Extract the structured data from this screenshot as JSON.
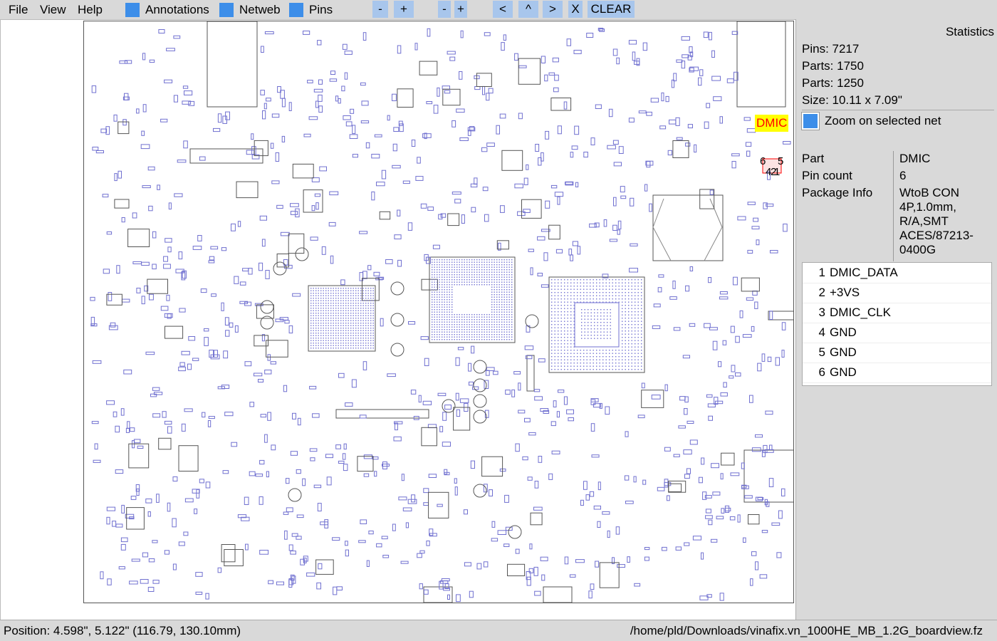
{
  "menu": {
    "file": "File",
    "view": "View",
    "help": "Help"
  },
  "toggles": {
    "annotations": "Annotations",
    "netweb": "Netweb",
    "pins": "Pins"
  },
  "buttons": {
    "zoom_out_1": "-",
    "zoom_in_1": "+",
    "zoom_out_2": "-",
    "zoom_in_2": "+",
    "prev": "<",
    "up": "^",
    "next": ">",
    "close": "X",
    "clear": "CLEAR"
  },
  "board": {
    "selected_part_label": "DMIC",
    "pin_6": "6",
    "pin_5": "5",
    "pin_4": "4",
    "pin_2": "2",
    "pin_1": "1"
  },
  "stats": {
    "title": "Statistics",
    "pins": "Pins: 7217",
    "parts1": "Parts: 1750",
    "parts2": "Parts: 1250",
    "size": "Size: 10.11 x 7.09\""
  },
  "zoom_selected": "Zoom on selected net",
  "part_info": {
    "part_label": "Part",
    "part_value": "DMIC",
    "pincount_label": "Pin count",
    "pincount_value": "6",
    "package_label": "Package Info",
    "package_value": "WtoB CON 4P,1.0mm, R/A,SMT ACES/87213-0400G"
  },
  "pins": [
    {
      "num": "1",
      "net": "DMIC_DATA"
    },
    {
      "num": "2",
      "net": "+3VS"
    },
    {
      "num": "3",
      "net": "DMIC_CLK"
    },
    {
      "num": "4",
      "net": "GND"
    },
    {
      "num": "5",
      "net": "GND"
    },
    {
      "num": "6",
      "net": "GND"
    }
  ],
  "status": {
    "position": "Position: 4.598\", 5.122\" (116.79, 130.10mm)",
    "file": "/home/pld/Downloads/vinafix.vn_1000HE_MB_1.2G_boardview.fz"
  },
  "colors": {
    "accent": "#3d8ee9",
    "button": "#a8c6ec",
    "component": "#7070d0",
    "outline": "#555555"
  }
}
